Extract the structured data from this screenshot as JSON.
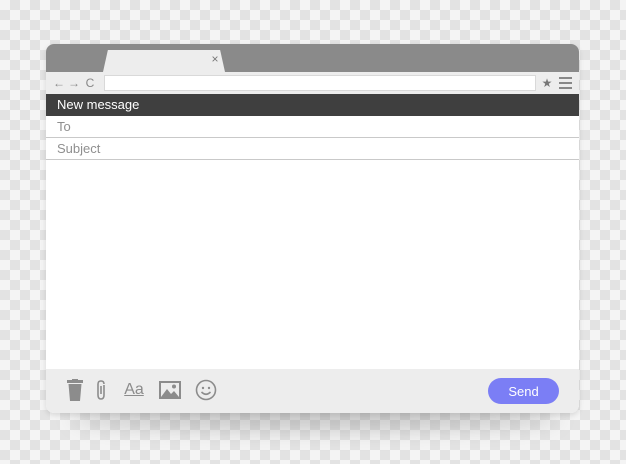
{
  "browser": {
    "tab_close_glyph": "×",
    "nav": {
      "back": "←",
      "forward": "→",
      "reload": "C"
    },
    "url": "",
    "bookmark_glyph": "★"
  },
  "compose": {
    "title": "New message",
    "to_placeholder": "To",
    "subject_placeholder": "Subject",
    "body": ""
  },
  "footer": {
    "icons": [
      "trash-icon",
      "attachment-icon",
      "text-format-icon",
      "image-icon",
      "emoji-icon"
    ],
    "format_label": "Aa",
    "send_label": "Send"
  },
  "colors": {
    "header_bg": "#3f3f3f",
    "send_button": "#7b7ef5",
    "titlebar": "#8a8a8a"
  }
}
